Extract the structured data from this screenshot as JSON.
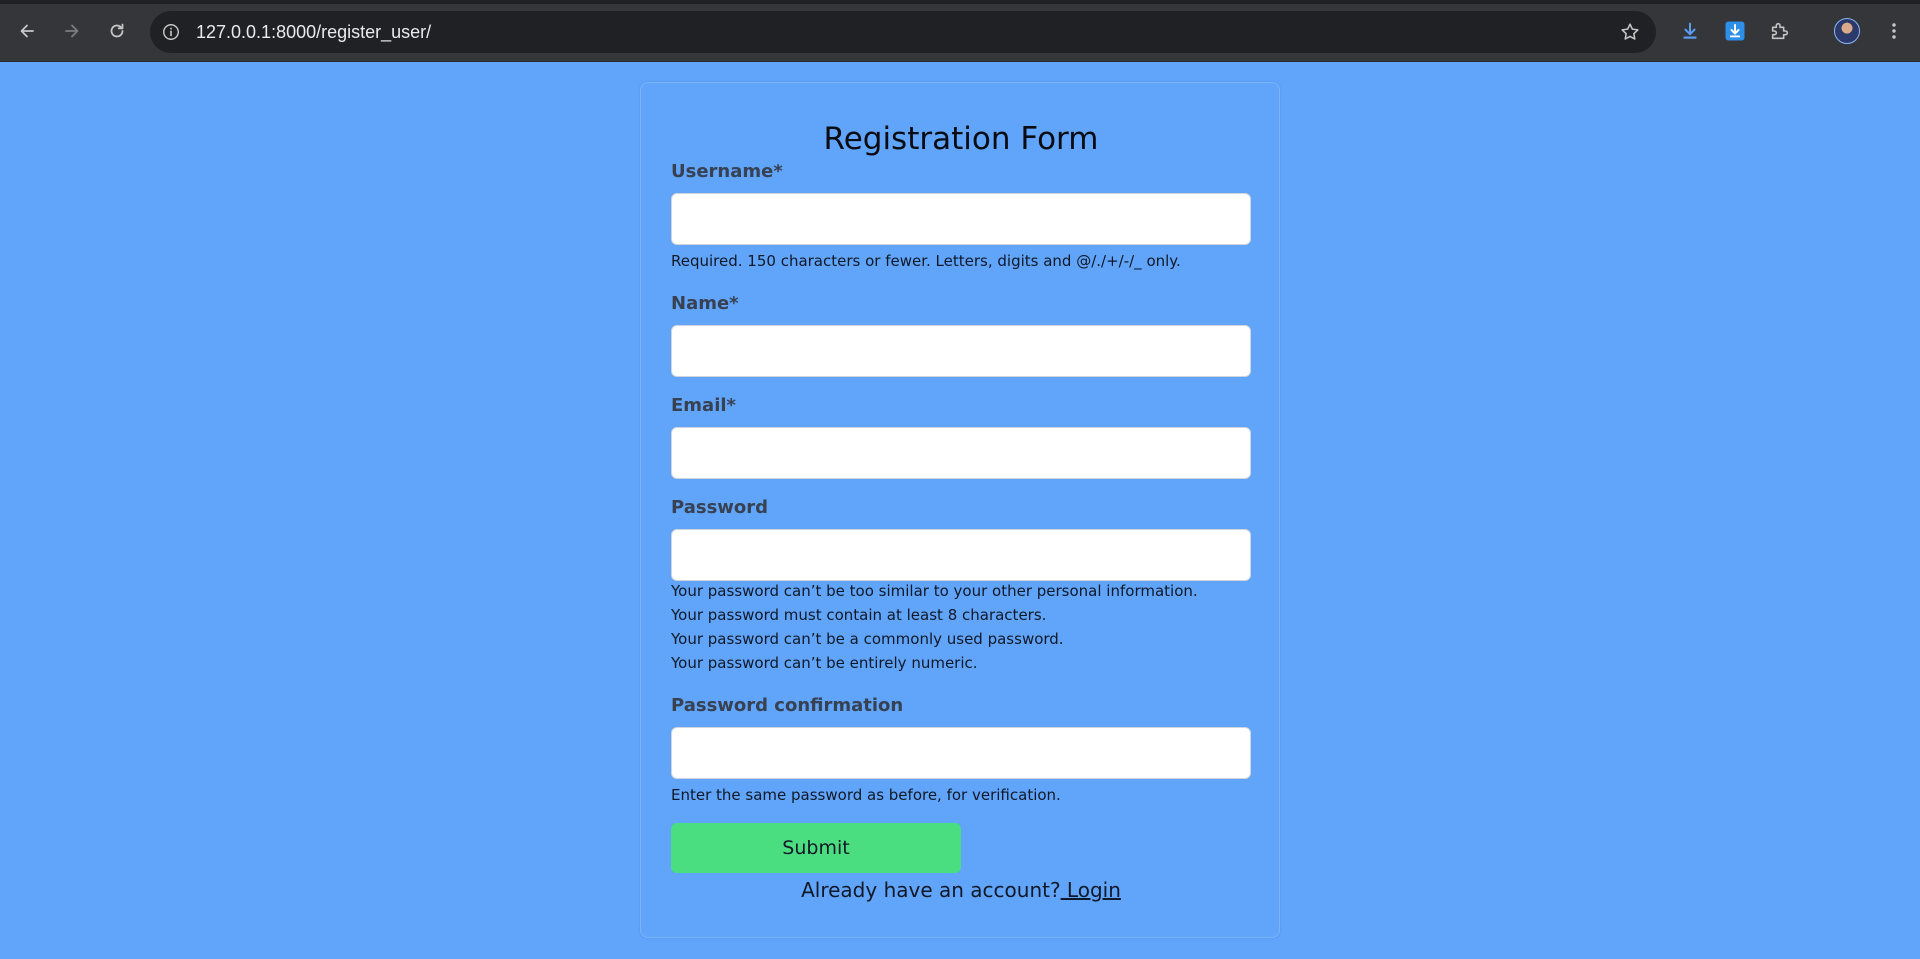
{
  "browser": {
    "url": "127.0.0.1:8000/register_user/",
    "icons": {
      "back": "arrow-left-icon",
      "forward": "arrow-right-icon",
      "reload": "reload-icon",
      "site_info": "info-icon",
      "bookmark": "star-icon",
      "downloads": "download-icon",
      "download_ext": "download-box-icon",
      "extensions": "puzzle-icon",
      "menu": "kebab-menu-icon"
    }
  },
  "form": {
    "title": "Registration Form",
    "fields": [
      {
        "label": "Username*",
        "value": "",
        "help": [
          "Required. 150 characters or fewer. Letters, digits and @/./+/-/_ only."
        ]
      },
      {
        "label": "Name*",
        "value": "",
        "help": []
      },
      {
        "label": "Email*",
        "value": "",
        "help": []
      },
      {
        "label": "Password",
        "value": "",
        "help": [
          "Your password can’t be too similar to your other personal information.",
          "Your password must contain at least 8 characters.",
          "Your password can’t be a commonly used password.",
          "Your password can’t be entirely numeric."
        ]
      },
      {
        "label": "Password confirmation",
        "value": "",
        "help": [
          "Enter the same password as before, for verification."
        ]
      }
    ],
    "submit_label": "Submit",
    "login_prompt": "Already have an account?",
    "login_link": " Login"
  },
  "colors": {
    "page_background": "#60a5fa",
    "submit_button": "#4ade80",
    "label_text": "#374151"
  }
}
